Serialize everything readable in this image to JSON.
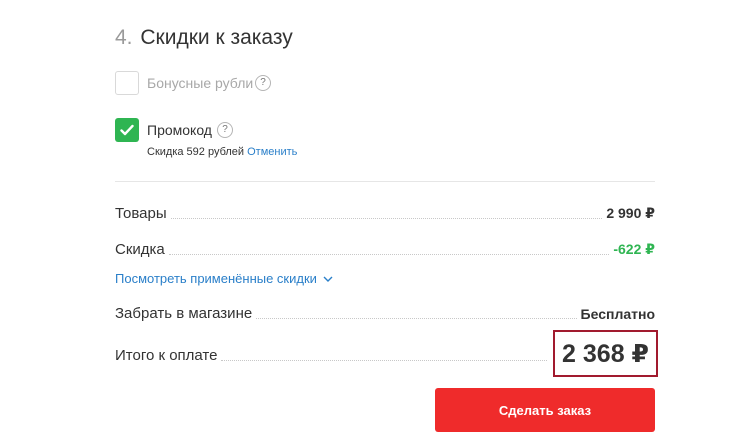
{
  "section": {
    "number": "4.",
    "title": "Скидки к заказу"
  },
  "bonus": {
    "label": "Бонусные рубли",
    "help": "?",
    "checked": false
  },
  "promo": {
    "label": "Промокод",
    "help": "?",
    "checked": true,
    "discount_text": "Скидка 592 рублей",
    "cancel_link": "Отменить"
  },
  "summary": {
    "goods_label": "Товары",
    "goods_value": "2 990 ₽",
    "discount_label": "Скидка",
    "discount_value": "-622 ₽",
    "show_discounts_link": "Посмотреть применённые скидки",
    "pickup_label": "Забрать в магазине",
    "pickup_value": "Бесплатно",
    "total_label": "Итого к оплате",
    "total_value": "2 368 ₽"
  },
  "actions": {
    "submit_label": "Сделать заказ"
  },
  "colors": {
    "accent_red": "#ef2b2b",
    "success_green": "#2fb552",
    "link_blue": "#2a7fc9",
    "highlight_border": "#a11a2e"
  }
}
